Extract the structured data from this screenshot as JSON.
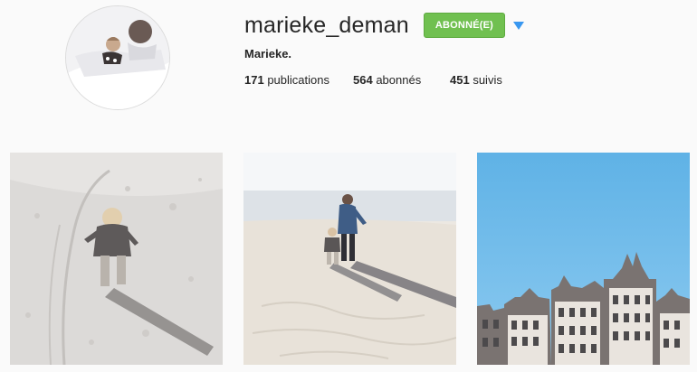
{
  "profile": {
    "username": "marieke_deman",
    "follow_button_label": "ABONNÉ(E)",
    "full_name": "Marieke.",
    "stats": {
      "publications_count": "171",
      "publications_label": "publications",
      "followers_count": "564",
      "followers_label": "abonnés",
      "following_count": "451",
      "following_label": "suivis"
    }
  },
  "colors": {
    "follow_button": "#70c050",
    "dropdown_arrow": "#3897f0",
    "background": "#fafafa"
  },
  "icons": {
    "dropdown": "caret-down-icon"
  }
}
